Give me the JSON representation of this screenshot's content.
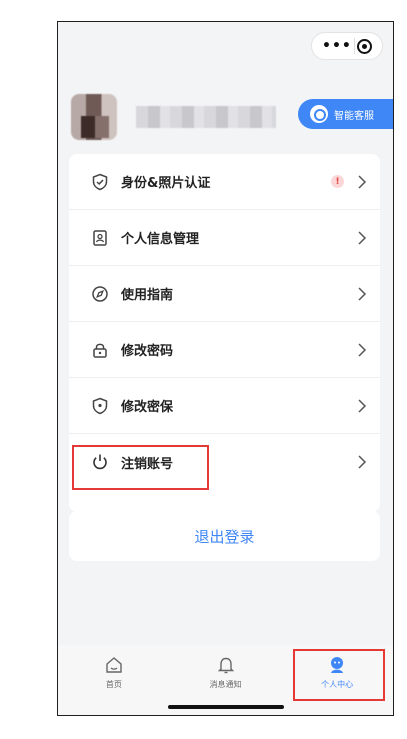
{
  "capsule": {
    "more_icon": "more-dots-icon",
    "close_icon": "target-icon"
  },
  "profile": {
    "service_label": "智能客服"
  },
  "menu": {
    "items": [
      {
        "label": "身份&照片认证",
        "icon": "shield-check-icon",
        "badge": "!"
      },
      {
        "label": "个人信息管理",
        "icon": "id-card-icon"
      },
      {
        "label": "使用指南",
        "icon": "compass-icon"
      },
      {
        "label": "修改密码",
        "icon": "lock-icon"
      },
      {
        "label": "修改密保",
        "icon": "shield-icon"
      },
      {
        "label": "注销账号",
        "icon": "power-icon"
      }
    ]
  },
  "logout_label": "退出登录",
  "tabbar": {
    "tabs": [
      {
        "label": "首页",
        "icon": "home-icon"
      },
      {
        "label": "消息通知",
        "icon": "bell-icon"
      },
      {
        "label": "个人中心",
        "icon": "user-icon",
        "active": true
      }
    ]
  },
  "colors": {
    "accent": "#3f86f7",
    "highlight": "#e53935",
    "warn": "#e64545"
  }
}
